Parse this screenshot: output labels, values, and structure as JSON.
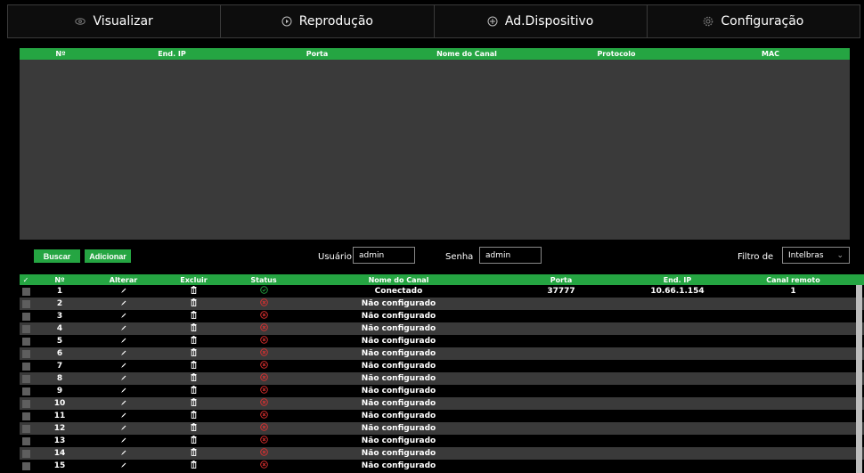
{
  "tabs": [
    {
      "label": "Visualizar",
      "icon": "eye-icon"
    },
    {
      "label": "Reprodução",
      "icon": "play-circle-icon"
    },
    {
      "label": "Ad.Dispositivo",
      "icon": "plus-circle-icon"
    },
    {
      "label": "Configuração",
      "icon": "gear-icon"
    }
  ],
  "upper_list": {
    "headers": [
      "Nº",
      "End. IP",
      "Porta",
      "Nome do Canal",
      "Protocolo",
      "MAC"
    ]
  },
  "controls": {
    "buscar": "Buscar",
    "adicionar": "Adicionar",
    "usuario_label": "Usuário",
    "usuario_value": "admin",
    "senha_label": "Senha",
    "senha_value": "admin",
    "filtro_label": "Filtro de",
    "filtro_value": "Intelbras"
  },
  "lower_list": {
    "headers": [
      "Nº",
      "Alterar",
      "Excluir",
      "Status",
      "Nome do Canal",
      "Porta",
      "End. IP",
      "Canal remoto"
    ],
    "rows": [
      {
        "n": "1",
        "status": "connected",
        "name": "Conectado",
        "porta": "37777",
        "ip": "10.66.1.154",
        "remoto": "1"
      },
      {
        "n": "2",
        "status": "error",
        "name": "Não configurado",
        "porta": "",
        "ip": "",
        "remoto": ""
      },
      {
        "n": "3",
        "status": "error",
        "name": "Não configurado",
        "porta": "",
        "ip": "",
        "remoto": ""
      },
      {
        "n": "4",
        "status": "error",
        "name": "Não configurado",
        "porta": "",
        "ip": "",
        "remoto": ""
      },
      {
        "n": "5",
        "status": "error",
        "name": "Não configurado",
        "porta": "",
        "ip": "",
        "remoto": ""
      },
      {
        "n": "6",
        "status": "error",
        "name": "Não configurado",
        "porta": "",
        "ip": "",
        "remoto": ""
      },
      {
        "n": "7",
        "status": "error",
        "name": "Não configurado",
        "porta": "",
        "ip": "",
        "remoto": ""
      },
      {
        "n": "8",
        "status": "error",
        "name": "Não configurado",
        "porta": "",
        "ip": "",
        "remoto": ""
      },
      {
        "n": "9",
        "status": "error",
        "name": "Não configurado",
        "porta": "",
        "ip": "",
        "remoto": ""
      },
      {
        "n": "10",
        "status": "error",
        "name": "Não configurado",
        "porta": "",
        "ip": "",
        "remoto": ""
      },
      {
        "n": "11",
        "status": "error",
        "name": "Não configurado",
        "porta": "",
        "ip": "",
        "remoto": ""
      },
      {
        "n": "12",
        "status": "error",
        "name": "Não configurado",
        "porta": "",
        "ip": "",
        "remoto": ""
      },
      {
        "n": "13",
        "status": "error",
        "name": "Não configurado",
        "porta": "",
        "ip": "",
        "remoto": ""
      },
      {
        "n": "14",
        "status": "error",
        "name": "Não configurado",
        "porta": "",
        "ip": "",
        "remoto": ""
      },
      {
        "n": "15",
        "status": "error",
        "name": "Não configurado",
        "porta": "",
        "ip": "",
        "remoto": ""
      }
    ]
  },
  "colors": {
    "accent": "#25a542",
    "row_alt": "#3a3a3a",
    "error": "#e03030"
  }
}
